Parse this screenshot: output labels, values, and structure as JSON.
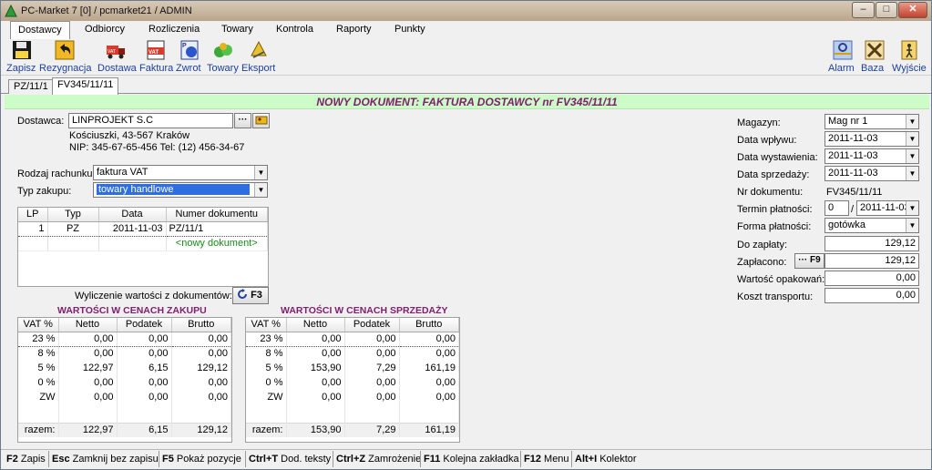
{
  "window": {
    "title": "PC-Market 7 [0] / pcmarket21 / ADMIN"
  },
  "menu": [
    {
      "label": "Dostawcy",
      "active": true
    },
    {
      "label": "Odbiorcy"
    },
    {
      "label": "Rozliczenia"
    },
    {
      "label": "Towary"
    },
    {
      "label": "Kontrola"
    },
    {
      "label": "Raporty"
    },
    {
      "label": "Punkty"
    }
  ],
  "toolbar": {
    "zapisz": "Zapisz",
    "rezygnacja": "Rezygnacja",
    "dostawa": "Dostawa",
    "faktura": "Faktura",
    "zwrot": "Zwrot",
    "towary": "Towary",
    "eksport": "Eksport",
    "alarm": "Alarm",
    "baza": "Baza",
    "wyjscie": "Wyjście",
    "faktura_icon_text": "VAT",
    "dostawa_icon_text": "VAT",
    "zwrot_icon_text": "P"
  },
  "doc_tabs": [
    "PZ/11/1",
    "FV345/11/11"
  ],
  "header": "NOWY DOKUMENT: FAKTURA DOSTAWCY nr FV345/11/11",
  "supplier": {
    "label": "Dostawca:",
    "name": "LINPROJEKT S.C",
    "address": "Kościuszki, 43-567 Kraków",
    "nip_tel": "NIP: 345-67-65-456 Tel: (12) 456-34-67",
    "browse_btn": "···"
  },
  "invoice_type": {
    "label": "Rodzaj rachunku:",
    "value": "faktura VAT"
  },
  "purchase_type": {
    "label": "Typ zakupu:",
    "value": "towary handlowe"
  },
  "docs_table": {
    "headers": [
      "LP",
      "Typ",
      "Data",
      "Numer dokumentu"
    ],
    "rows": [
      [
        "1",
        "PZ",
        "2011-11-03",
        "PZ/11/1"
      ]
    ],
    "new_doc": "<nowy dokument>"
  },
  "calc": {
    "label": "Wyliczenie wartości z dokumentów:",
    "key": "F3"
  },
  "purchase_values": {
    "title": "WARTOŚCI W CENACH ZAKUPU",
    "headers": [
      "VAT %",
      "Netto",
      "Podatek",
      "Brutto"
    ],
    "rows": [
      [
        "23 %",
        "0,00",
        "0,00",
        "0,00"
      ],
      [
        "8 %",
        "0,00",
        "0,00",
        "0,00"
      ],
      [
        "5 %",
        "122,97",
        "6,15",
        "129,12"
      ],
      [
        "0 %",
        "0,00",
        "0,00",
        "0,00"
      ],
      [
        "ZW",
        "0,00",
        "0,00",
        "0,00"
      ]
    ],
    "total": [
      "razem:",
      "122,97",
      "6,15",
      "129,12"
    ]
  },
  "sale_values": {
    "title": "WARTOŚCI W CENACH SPRZEDAŻY",
    "headers": [
      "VAT %",
      "Netto",
      "Podatek",
      "Brutto"
    ],
    "rows": [
      [
        "23 %",
        "0,00",
        "0,00",
        "0,00"
      ],
      [
        "8 %",
        "0,00",
        "0,00",
        "0,00"
      ],
      [
        "5 %",
        "153,90",
        "7,29",
        "161,19"
      ],
      [
        "0 %",
        "0,00",
        "0,00",
        "0,00"
      ],
      [
        "ZW",
        "0,00",
        "0,00",
        "0,00"
      ]
    ],
    "total": [
      "razem:",
      "153,90",
      "7,29",
      "161,19"
    ]
  },
  "right": {
    "magazyn": {
      "label": "Magazyn:",
      "value": "Mag nr 1"
    },
    "data_wplywu": {
      "label": "Data wpływu:",
      "value": "2011-11-03"
    },
    "data_wystawienia": {
      "label": "Data wystawienia:",
      "value": "2011-11-03"
    },
    "data_sprzedazy": {
      "label": "Data sprzedaży:",
      "value": "2011-11-03"
    },
    "nr_dokumentu": {
      "label": "Nr dokumentu:",
      "value": "FV345/11/11"
    },
    "termin": {
      "label": "Termin płatności:",
      "days": "0",
      "slash": "/",
      "date": "2011-11-03"
    },
    "forma": {
      "label": "Forma płatności:",
      "value": "gotówka"
    },
    "do_zaplaty": {
      "label": "Do zapłaty:",
      "value": "129,12"
    },
    "zaplacono": {
      "label": "Zapłacono:",
      "btn": "··· F9",
      "value": "129,12"
    },
    "opakowan": {
      "label": "Wartość opakowań:",
      "value": "0,00"
    },
    "transport": {
      "label": "Koszt transportu:",
      "value": "0,00"
    }
  },
  "status": [
    {
      "key": "F2",
      "label": "Zapis"
    },
    {
      "key": "Esc",
      "label": "Zamknij bez zapisu"
    },
    {
      "key": "F5",
      "label": "Pokaż pozycje"
    },
    {
      "key": "Ctrl+T",
      "label": "Dod. teksty"
    },
    {
      "key": "Ctrl+Z",
      "label": "Zamrożenie"
    },
    {
      "key": "F11",
      "label": "Kolejna zakładka"
    },
    {
      "key": "F12",
      "label": "Menu"
    },
    {
      "key": "Alt+I",
      "label": "Kolektor"
    }
  ]
}
